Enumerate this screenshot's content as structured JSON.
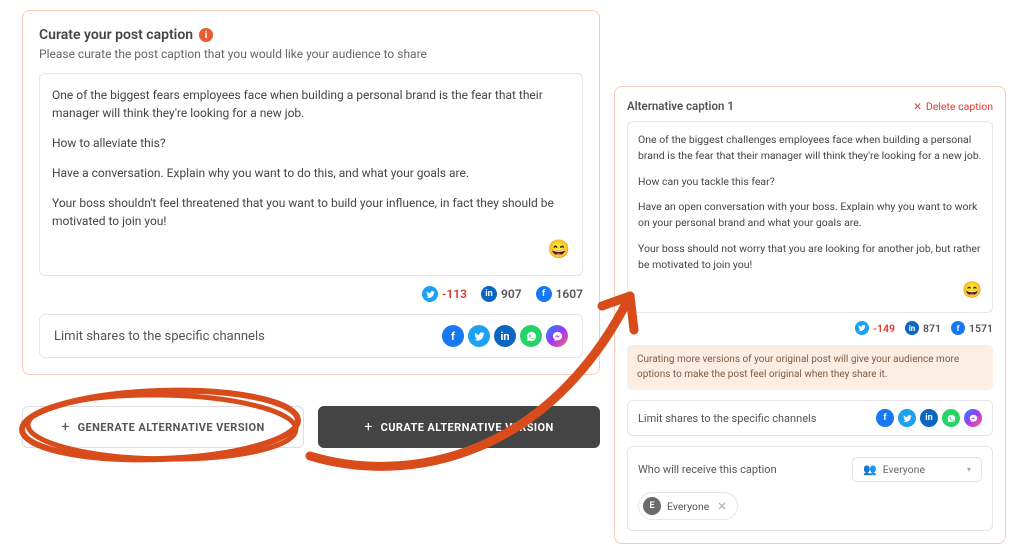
{
  "left": {
    "title": "Curate your post caption",
    "subtitle": "Please curate the post caption that you would like your audience to share",
    "caption": {
      "p1": "One of the biggest fears employees face when building a personal brand is the fear that their manager will think they're looking for a new job.",
      "p2": "How to alleviate this?",
      "p3": "Have a conversation. Explain why you want to do this, and what your goals are.",
      "p4": "Your boss shouldn't feel threatened that you want to build your influence, in fact they should be motivated to join you!",
      "emoji": "😄"
    },
    "counts": {
      "twitter": "-113",
      "linkedin": "907",
      "facebook": "1607"
    },
    "limit_label": "Limit shares to the specific channels"
  },
  "buttons": {
    "generate": "GENERATE ALTERNATIVE VERSION",
    "curate": "CURATE ALTERNATIVE VERSION"
  },
  "right": {
    "title": "Alternative caption 1",
    "delete_label": "Delete caption",
    "caption": {
      "p1": "One of the biggest challenges employees face when building a personal brand is the fear that their manager will think they're looking for a new job.",
      "p2": "How can you tackle this fear?",
      "p3": "Have an open conversation with your boss. Explain why you want to work on your personal brand and what your goals are.",
      "p4": "Your boss should not worry that you are looking for another job, but rather be motivated to join you!",
      "emoji": "😄"
    },
    "counts": {
      "twitter": "-149",
      "linkedin": "871",
      "facebook": "1571"
    },
    "tip": "Curating more versions of your original post will give your audience more options to make the post feel original when they share it.",
    "limit_label": "Limit shares to the specific channels",
    "receive_label": "Who will receive this caption",
    "dropdown_value": "Everyone",
    "chip_initial": "E",
    "chip_label": "Everyone"
  },
  "colors": {
    "accent": "#e65c2e",
    "scribble": "#d84b1a"
  }
}
